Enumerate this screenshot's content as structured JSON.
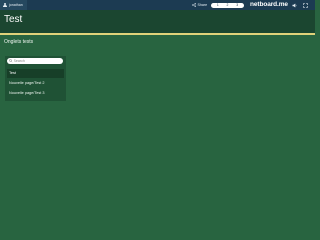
{
  "topbar": {
    "user_label": "jonathan",
    "share_label": "Share",
    "pill_items": [
      "1",
      "2",
      "3"
    ],
    "brand": "netboard.me"
  },
  "header": {
    "title": "Test"
  },
  "main": {
    "section_title": "Onglets tests",
    "search_placeholder": "Search",
    "tabs": [
      {
        "label": "Test"
      },
      {
        "label": "Nouvelle page/Test 2"
      },
      {
        "label": "Nouvelle page/Test 3"
      }
    ]
  },
  "colors": {
    "page_bg": "#286440",
    "header_bg": "#1b4630",
    "topbar_bg": "#1c3b52",
    "accent": "#e0d27a"
  },
  "icons": [
    "user-icon",
    "share-icon",
    "speaker-icon",
    "expand-icon",
    "search-icon"
  ]
}
